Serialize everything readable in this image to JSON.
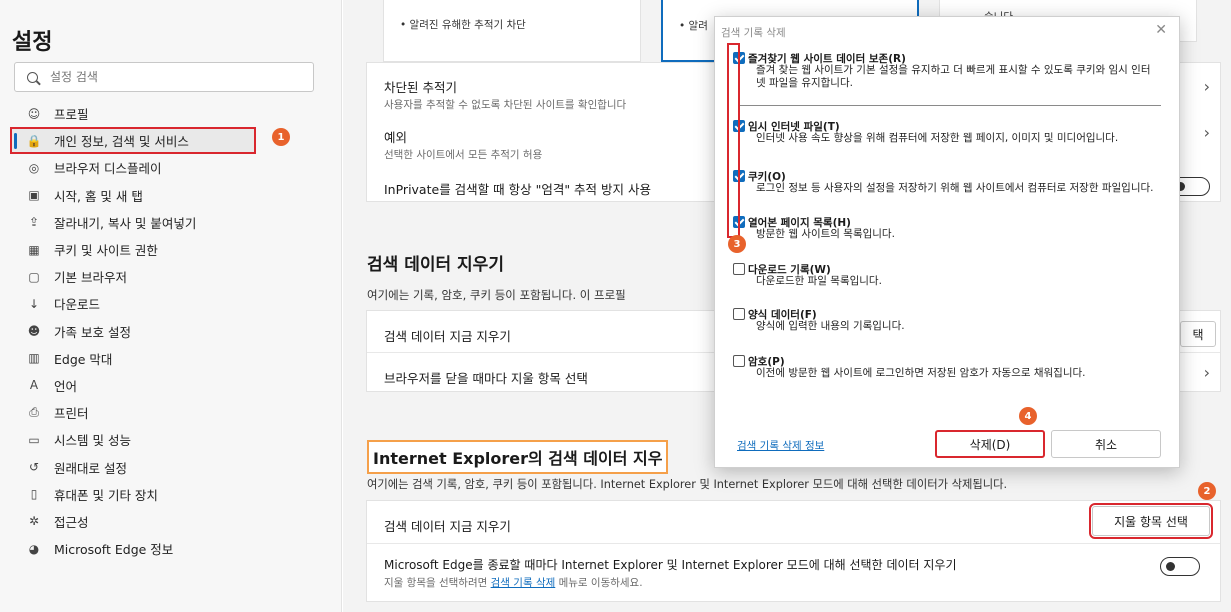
{
  "sidebar": {
    "title": "설정",
    "search_placeholder": "설정 검색",
    "items": [
      {
        "label": "프로필",
        "icon": "profile-icon",
        "glyph": "☺"
      },
      {
        "label": "개인 정보, 검색 및 서비스",
        "icon": "lock-icon",
        "glyph": "🔒"
      },
      {
        "label": "브라우저 디스플레이",
        "icon": "palette-icon",
        "glyph": "◎"
      },
      {
        "label": "시작, 홈 및 새 탭",
        "icon": "home-tab-icon",
        "glyph": "▣"
      },
      {
        "label": "잘라내기, 복사 및 붙여넣기",
        "icon": "share-icon",
        "glyph": "⇪"
      },
      {
        "label": "쿠키 및 사이트 권한",
        "icon": "permissions-icon",
        "glyph": "▦"
      },
      {
        "label": "기본 브라우저",
        "icon": "browser-icon",
        "glyph": "▢"
      },
      {
        "label": "다운로드",
        "icon": "download-icon",
        "glyph": "↓"
      },
      {
        "label": "가족 보호 설정",
        "icon": "family-icon",
        "glyph": "☻"
      },
      {
        "label": "Edge 막대",
        "icon": "edge-bar-icon",
        "glyph": "▥"
      },
      {
        "label": "언어",
        "icon": "language-icon",
        "glyph": "A"
      },
      {
        "label": "프린터",
        "icon": "printer-icon",
        "glyph": "⎙"
      },
      {
        "label": "시스템 및 성능",
        "icon": "system-icon",
        "glyph": "▭"
      },
      {
        "label": "원래대로 설정",
        "icon": "reset-icon",
        "glyph": "↺"
      },
      {
        "label": "휴대폰 및 기타 장치",
        "icon": "phone-icon",
        "glyph": "▯"
      },
      {
        "label": "접근성",
        "icon": "accessibility-icon",
        "glyph": "✲"
      },
      {
        "label": "Microsoft Edge 정보",
        "icon": "edge-logo-icon",
        "glyph": "◕"
      }
    ]
  },
  "main": {
    "blocked_tracker_line": "알려진 유해한 추적기 차단",
    "blocked_tracker_line_2": "알려",
    "card_top_right": "습니다",
    "blocked_trackers_title": "차단된 추적기",
    "blocked_trackers_desc": "사용자를 추적할 수 없도록 차단된 사이트를 확인합니다",
    "exceptions_title": "예외",
    "exceptions_desc": "선택한 사이트에서 모든 추적기 허용",
    "inprivate_label": "InPrivate를 검색할 때 항상 \"엄격\" 추적 방지 사용",
    "clear_data_heading": "검색 데이터 지우기",
    "clear_data_desc": "여기에는 기록, 암호, 쿠키 등이 포함됩니다. 이 프로필",
    "clear_now_label": "검색 데이터 지금 지우기",
    "clear_now_btn_partial": "택",
    "on_close_label": "브라우저를 닫을 때마다 지울 항목 선택",
    "ie_heading": "Internet Explorer의 검색 데이터 지우",
    "ie_desc": "여기에는 검색 기록, 암호, 쿠키 등이 포함됩니다. Internet Explorer 및 Internet Explorer 모드에 대해 선택한 데이터가 삭제됩니다.",
    "ie_clear_now_label": "검색 데이터 지금 지우기",
    "ie_choose_btn": "지울 항목 선택",
    "ie_on_exit_label": "Microsoft Edge를 종료할 때마다 Internet Explorer 및 Internet Explorer 모드에 대해 선택한 데이터 지우기",
    "ie_on_exit_desc_prefix": "지울 항목을 선택하려면 ",
    "ie_on_exit_desc_link": "검색 기록 삭제",
    "ie_on_exit_desc_suffix": " 메뉴로 이동하세요."
  },
  "dialog": {
    "title": "검색 기록 삭제",
    "close": "✕",
    "options": [
      {
        "title": "즐겨찾기 웹 사이트 데이터 보존(R)",
        "desc": "즐겨 찾는 웹 사이트가 기본 설정을 유지하고 더 빠르게 표시할 수 있도록 쿠키와 임시 인터넷 파일을 유지합니다.",
        "checked": true
      },
      {
        "title": "임시 인터넷 파일(T)",
        "desc": "인터넷 사용 속도 향상을 위해 컴퓨터에 저장한 웹 페이지, 이미지 및 미디어입니다.",
        "checked": true
      },
      {
        "title": "쿠키(O)",
        "desc": "로그인 정보 등 사용자의 설정을 저장하기 위해 웹 사이트에서 컴퓨터로 저장한 파일입니다.",
        "checked": true
      },
      {
        "title": "열어본 페이지 목록(H)",
        "desc": "방문한 웹 사이트의 목록입니다.",
        "checked": true
      },
      {
        "title": "다운로드 기록(W)",
        "desc": "다운로드한 파일 목록입니다.",
        "checked": false
      },
      {
        "title": "양식 데이터(F)",
        "desc": "양식에 입력한 내용의 기록입니다.",
        "checked": false
      },
      {
        "title": "암호(P)",
        "desc": "이전에 방문한 웹 사이트에 로그인하면 저장된 암호가 자동으로 채워집니다.",
        "checked": false
      }
    ],
    "info_link": "검색 기록 삭제 정보",
    "delete_btn": "삭제(D)",
    "cancel_btn": "취소"
  },
  "badges": [
    "1",
    "2",
    "3",
    "4"
  ],
  "colors": {
    "accent": "#0f6cbd",
    "highlight_red": "#d9272e",
    "highlight_orange": "#f5a04a",
    "badge": "#e8622c"
  }
}
